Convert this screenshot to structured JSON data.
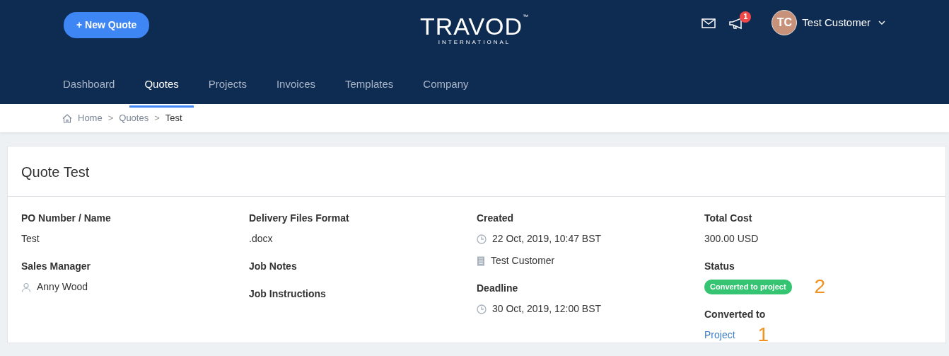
{
  "header": {
    "new_quote_button": "+ New Quote",
    "logo": {
      "name": "TRAVOD",
      "trademark": "™",
      "tagline": "INTERNATIONAL"
    },
    "notification_count": "1",
    "user": {
      "initials": "TC",
      "name": "Test Customer"
    }
  },
  "tabs": [
    {
      "label": "Dashboard",
      "selected": false
    },
    {
      "label": "Quotes",
      "selected": true
    },
    {
      "label": "Projects",
      "selected": false
    },
    {
      "label": "Invoices",
      "selected": false
    },
    {
      "label": "Templates",
      "selected": false
    },
    {
      "label": "Company",
      "selected": false
    }
  ],
  "breadcrumb": [
    {
      "label": "Home",
      "current": false
    },
    {
      "label": "Quotes",
      "current": false
    },
    {
      "label": "Test",
      "current": true
    }
  ],
  "breadcrumb_separators": [
    ">",
    ">"
  ],
  "card": {
    "title": "Quote Test",
    "columns": [
      [
        {
          "label": "PO Number / Name",
          "values": [
            {
              "kind": "text",
              "text": "Test"
            }
          ]
        },
        {
          "label": "Sales Manager",
          "values": [
            {
              "kind": "person",
              "text": "Anny Wood"
            }
          ]
        }
      ],
      [
        {
          "label": "Delivery Files Format",
          "values": [
            {
              "kind": "text",
              "text": ".docx"
            }
          ]
        },
        {
          "label": "Job Notes"
        },
        {
          "label": "Job Instructions"
        }
      ],
      [
        {
          "label": "Created",
          "values": [
            {
              "kind": "time",
              "text": "22 Oct, 2019, 10:47 BST"
            },
            {
              "kind": "company",
              "text": "Test Customer"
            }
          ]
        },
        {
          "label": "Deadline",
          "values": [
            {
              "kind": "time",
              "text": "30 Oct, 2019, 12:00 BST"
            }
          ]
        }
      ],
      [
        {
          "label": "Total Cost",
          "values": [
            {
              "kind": "text",
              "text": "300.00 USD"
            }
          ]
        },
        {
          "label": "Status",
          "values": [
            {
              "kind": "badge",
              "text": "Converted to project",
              "color": "#34c472",
              "annotation": "2"
            }
          ]
        },
        {
          "label": "Converted to",
          "values": [
            {
              "kind": "link",
              "text": "Project",
              "annotation": "1"
            }
          ]
        }
      ]
    ]
  }
}
